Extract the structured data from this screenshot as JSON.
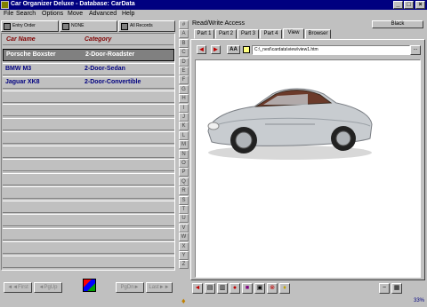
{
  "window": {
    "title": "Car Organizer Deluxe - Database: CarData"
  },
  "menu": [
    "File",
    "Search",
    "Options",
    "Move",
    "Advanced",
    "Help"
  ],
  "toolbar": {
    "entry_order": "Entry Order",
    "filter": "NONE",
    "all_records": "All Records"
  },
  "list": {
    "columns": [
      "Car Name",
      "Category"
    ],
    "rows": [
      {
        "name": "Porsche Boxster",
        "category": "2-Door-Roadster"
      },
      {
        "name": "BMW M3",
        "category": "2-Door-Sedan"
      },
      {
        "name": "Jaguar XK8",
        "category": "2-Door-Convertible"
      }
    ],
    "selected_index": 0
  },
  "nav": {
    "first": "First",
    "pgup": "PgUp",
    "pgdn": "PgDn",
    "last": "Last"
  },
  "alphabet": [
    "#",
    "A",
    "B",
    "C",
    "D",
    "E",
    "F",
    "G",
    "H",
    "I",
    "J",
    "K",
    "L",
    "M",
    "N",
    "O",
    "P",
    "Q",
    "R",
    "S",
    "T",
    "U",
    "V",
    "W",
    "X",
    "Y",
    "Z"
  ],
  "detail": {
    "access": "Read/Write Access",
    "color_label": "Black",
    "tabs": [
      "Part 1",
      "Part 2",
      "Part 3",
      "Part 4",
      "View",
      "Browser"
    ],
    "active_tab": "View",
    "aa_label": "AA",
    "path": "C:\\_nexl\\cardata\\view\\view1.htm",
    "path_button": "...",
    "zoom": "33%"
  },
  "colors": {
    "title_bg": "#000080",
    "header_text": "#800000",
    "row_text": "#000080",
    "car_body": "#c8ccd0"
  }
}
